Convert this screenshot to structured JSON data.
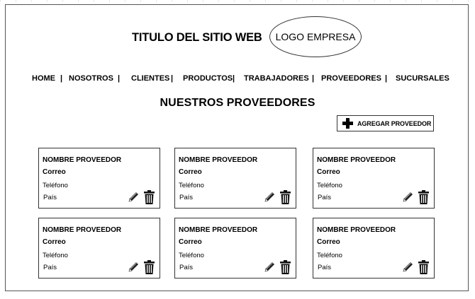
{
  "header": {
    "site_title": "TITULO DEL SITIO WEB",
    "logo_text": "LOGO EMPRESA"
  },
  "nav": {
    "items": [
      {
        "label": "HOME"
      },
      {
        "label": "NOSOTROS"
      },
      {
        "label": "CLIENTES"
      },
      {
        "label": "PRODUCTOS"
      },
      {
        "label": "TRABAJADORES"
      },
      {
        "label": "PROVEEDORES"
      },
      {
        "label": "SUCURSALES"
      }
    ],
    "separator": "|"
  },
  "main": {
    "section_title": "NUESTROS PROVEEDORES",
    "add_button_label": "AGREGAR PROVEEDOR",
    "add_button_icon": "plus-icon",
    "cards": [
      {
        "name": "NOMBRE PROVEEDOR",
        "email": "Correo",
        "phone": "Teléfono",
        "country": "País"
      },
      {
        "name": "NOMBRE PROVEEDOR",
        "email": "Correo",
        "phone": "Teléfono",
        "country": "País"
      },
      {
        "name": "NOMBRE PROVEEDOR",
        "email": "Correo",
        "phone": "Teléfono",
        "country": "País"
      },
      {
        "name": "NOMBRE PROVEEDOR",
        "email": "Correo",
        "phone": "Teléfono",
        "country": "País"
      },
      {
        "name": "NOMBRE PROVEEDOR",
        "email": "Correo",
        "phone": "Teléfono",
        "country": "País"
      },
      {
        "name": "NOMBRE PROVEEDOR",
        "email": "Correo",
        "phone": "Teléfono",
        "country": "País"
      }
    ],
    "card_icons": {
      "edit": "pencil-icon",
      "delete": "trash-icon"
    }
  }
}
